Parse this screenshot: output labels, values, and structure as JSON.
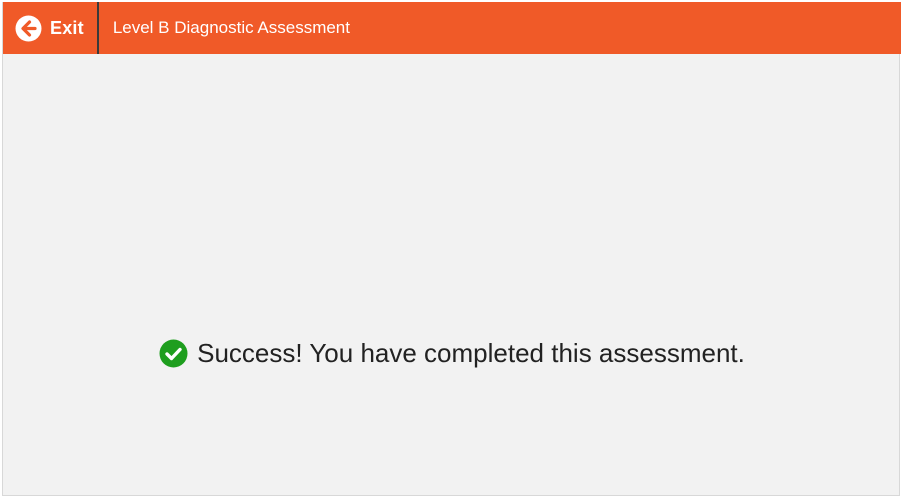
{
  "header": {
    "exit_label": "Exit",
    "title": "Level B Diagnostic Assessment",
    "exit_icon": "arrow-left-circle-icon",
    "background_color": "#f05a28"
  },
  "main": {
    "message": "Success! You have completed this assessment.",
    "status_icon": "check-circle-icon",
    "status_color": "#1e9e1e"
  }
}
